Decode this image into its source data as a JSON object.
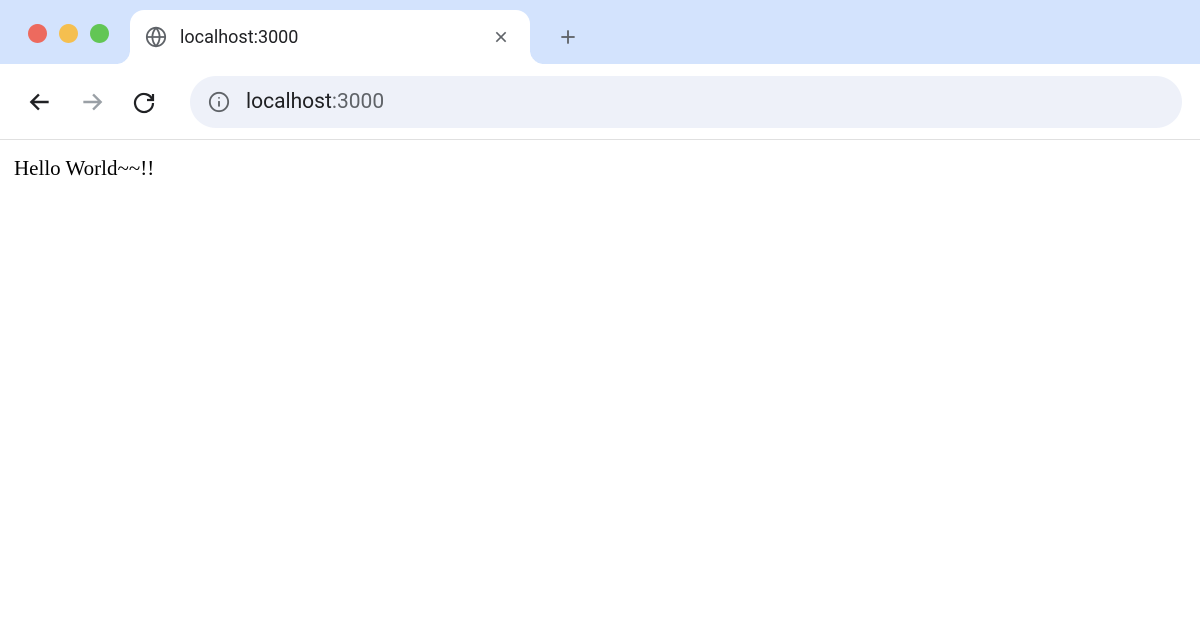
{
  "window": {
    "controls": [
      "close",
      "minimize",
      "maximize"
    ]
  },
  "tab": {
    "title": "localhost:3000"
  },
  "address": {
    "host": "localhost",
    "port": ":3000"
  },
  "page": {
    "body_text": "Hello World~~!!"
  }
}
